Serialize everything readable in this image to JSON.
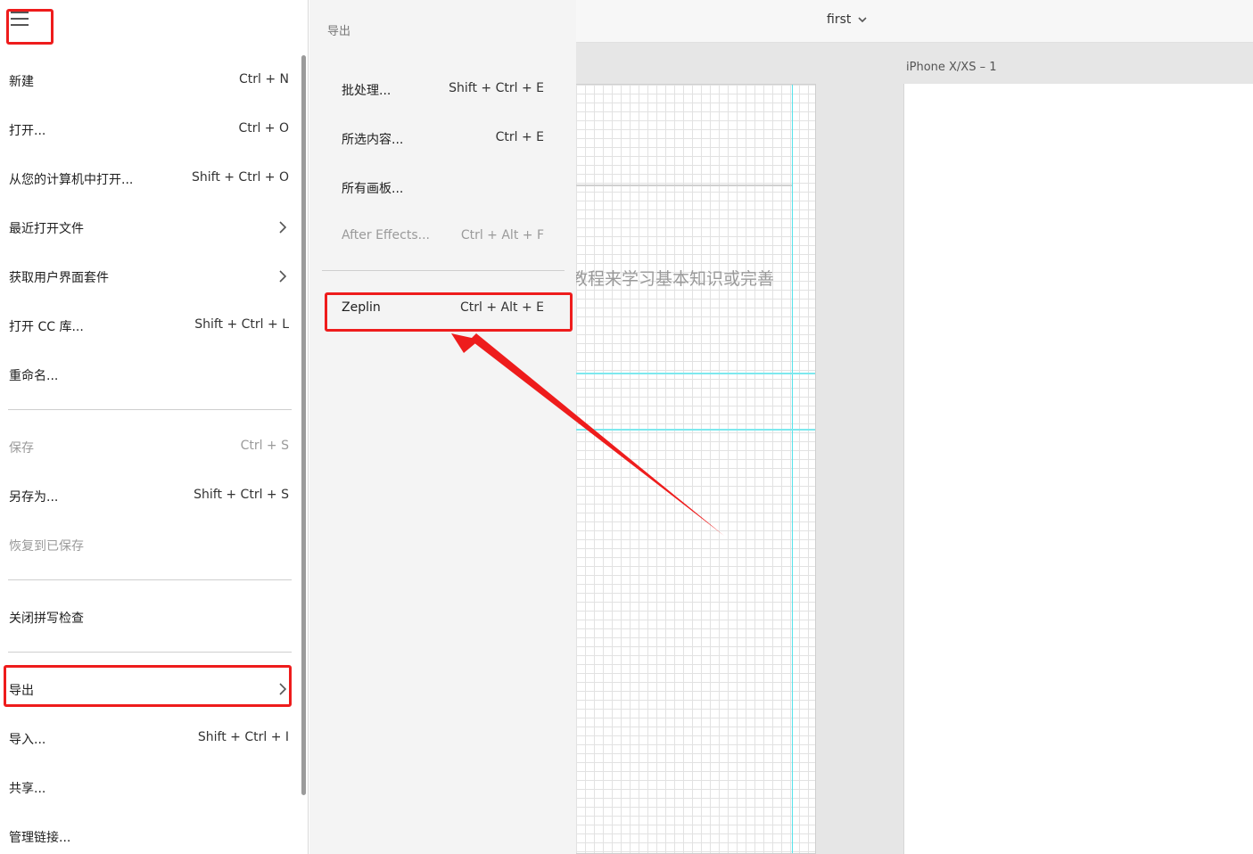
{
  "canvas": {
    "document_title": "first",
    "artboard_text": "教程来学习基本知识或完善",
    "artboard_b_label": "iPhone X/XS – 1"
  },
  "main_menu": {
    "items": [
      {
        "label": "新建",
        "shortcut": "Ctrl + N"
      },
      {
        "label": "打开...",
        "shortcut": "Ctrl + O"
      },
      {
        "label": "从您的计算机中打开...",
        "shortcut": "Shift + Ctrl + O"
      },
      {
        "label": "最近打开文件",
        "shortcut": ""
      },
      {
        "label": "获取用户界面套件",
        "shortcut": ""
      },
      {
        "label": "打开 CC 库...",
        "shortcut": "Shift + Ctrl + L"
      },
      {
        "label": "重命名...",
        "shortcut": ""
      },
      {
        "label": "保存",
        "shortcut": "Ctrl + S"
      },
      {
        "label": "另存为...",
        "shortcut": "Shift + Ctrl + S"
      },
      {
        "label": "恢复到已保存",
        "shortcut": ""
      },
      {
        "label": "关闭拼写检查",
        "shortcut": ""
      },
      {
        "label": "导出",
        "shortcut": ""
      },
      {
        "label": "导入...",
        "shortcut": "Shift + Ctrl + I"
      },
      {
        "label": "共享...",
        "shortcut": ""
      },
      {
        "label": "管理链接...",
        "shortcut": ""
      }
    ]
  },
  "export_menu": {
    "title": "导出",
    "items": [
      {
        "label": "批处理...",
        "shortcut": "Shift + Ctrl + E"
      },
      {
        "label": "所选内容...",
        "shortcut": "Ctrl + E"
      },
      {
        "label": "所有画板...",
        "shortcut": ""
      },
      {
        "label": "After Effects...",
        "shortcut": "Ctrl + Alt + F"
      },
      {
        "label": "Zeplin",
        "shortcut": "Ctrl + Alt + E"
      }
    ]
  },
  "colors": {
    "annotation_red": "#ee1c1c",
    "guide_cyan": "#55e2ea",
    "disabled_text": "#9a9a9a"
  }
}
